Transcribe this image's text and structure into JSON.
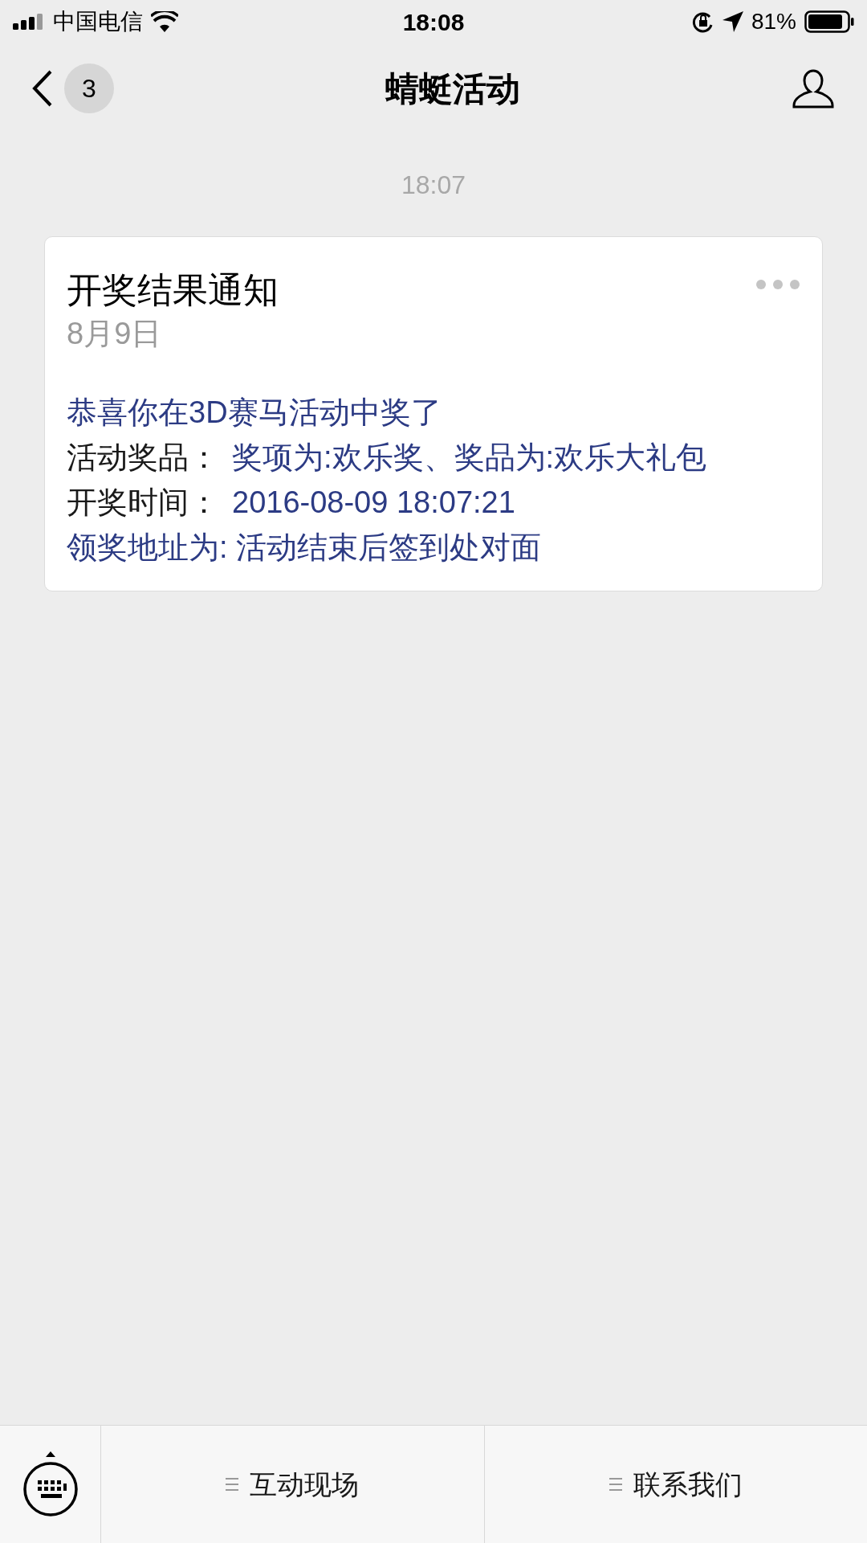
{
  "status_bar": {
    "carrier": "中国电信",
    "time": "18:08",
    "battery": "81%"
  },
  "nav": {
    "back_count": "3",
    "title": "蜻蜓活动"
  },
  "timestamp": "18:07",
  "card": {
    "title": "开奖结果通知",
    "date": "8月9日",
    "lines": [
      {
        "value": "恭喜你在3D赛马活动中奖了"
      },
      {
        "label": "活动奖品：",
        "value": "奖项为:欢乐奖、奖品为:欢乐大礼包"
      },
      {
        "label": "开奖时间：",
        "value": "2016-08-09 18:07:21"
      },
      {
        "value": "领奖地址为: 活动结束后签到处对面"
      }
    ]
  },
  "menu": [
    {
      "label": "互动现场"
    },
    {
      "label": "联系我们"
    }
  ]
}
